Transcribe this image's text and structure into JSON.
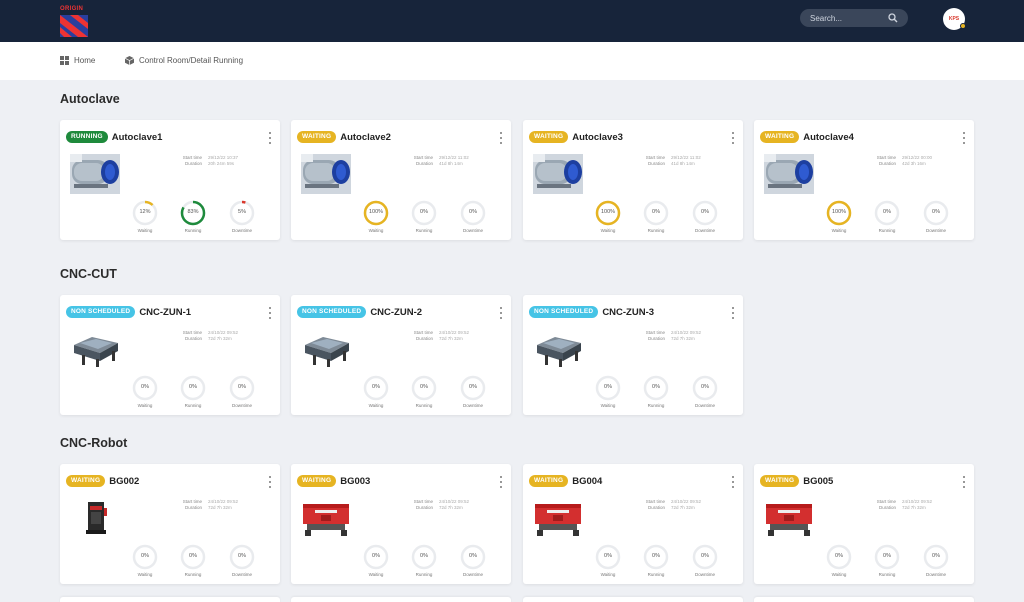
{
  "header": {
    "logo_text": "ORIGIN",
    "search_placeholder": "Search...",
    "avatar_initials": "KPS",
    "colors": {
      "bar": "#17243a",
      "accent": "#d9372b"
    }
  },
  "breadcrumb": {
    "home": "Home",
    "current": "Control Room/Detail Running"
  },
  "status_colors": {
    "RUNNING": "#1e8a3c",
    "WAITING": "#e6b422",
    "NON SCHEDULED": "#46c4e6"
  },
  "info_labels": {
    "start": "Start time",
    "duration": "Duration"
  },
  "sections": [
    {
      "title": "Autoclave",
      "machine_type": "autoclave",
      "cards": [
        {
          "status": "RUNNING",
          "name": "Autoclave1",
          "start": "29/12/22 10:37",
          "duration": "20h 24m 59s",
          "gauges": [
            {
              "label": "Waiting",
              "value": "12%",
              "pct": 12,
              "color": "#e6b422"
            },
            {
              "label": "Running",
              "value": "83%",
              "pct": 83,
              "color": "#1e8a3c"
            },
            {
              "label": "Downtime",
              "value": "5%",
              "pct": 5,
              "color": "#d9372b"
            }
          ]
        },
        {
          "status": "WAITING",
          "name": "Autoclave2",
          "start": "29/12/22 11:02",
          "duration": "41d 8h 14m",
          "gauges": [
            {
              "label": "Waiting",
              "value": "100%",
              "pct": 100,
              "color": "#e6b422"
            },
            {
              "label": "Running",
              "value": "0%",
              "pct": 0,
              "color": "#1e8a3c"
            },
            {
              "label": "Downtime",
              "value": "0%",
              "pct": 0,
              "color": "#d9372b"
            }
          ]
        },
        {
          "status": "WAITING",
          "name": "Autoclave3",
          "start": "29/12/22 11:02",
          "duration": "41d 8h 14m",
          "gauges": [
            {
              "label": "Waiting",
              "value": "100%",
              "pct": 100,
              "color": "#e6b422"
            },
            {
              "label": "Running",
              "value": "0%",
              "pct": 0,
              "color": "#1e8a3c"
            },
            {
              "label": "Downtime",
              "value": "0%",
              "pct": 0,
              "color": "#d9372b"
            }
          ]
        },
        {
          "status": "WAITING",
          "name": "Autoclave4",
          "start": "29/12/22 00:00",
          "duration": "42d 3h 16m",
          "gauges": [
            {
              "label": "Waiting",
              "value": "100%",
              "pct": 100,
              "color": "#e6b422"
            },
            {
              "label": "Running",
              "value": "0%",
              "pct": 0,
              "color": "#1e8a3c"
            },
            {
              "label": "Downtime",
              "value": "0%",
              "pct": 0,
              "color": "#d9372b"
            }
          ]
        }
      ]
    },
    {
      "title": "CNC-CUT",
      "machine_type": "cnc",
      "cards": [
        {
          "status": "NON SCHEDULED",
          "name": "CNC-ZUN-1",
          "start": "24/10/22 09:52",
          "duration": "72d 7h 32m",
          "gauges": [
            {
              "label": "Waiting",
              "value": "0%",
              "pct": 0,
              "color": "#e6b422"
            },
            {
              "label": "Running",
              "value": "0%",
              "pct": 0,
              "color": "#1e8a3c"
            },
            {
              "label": "Downtime",
              "value": "0%",
              "pct": 0,
              "color": "#d9372b"
            }
          ]
        },
        {
          "status": "NON SCHEDULED",
          "name": "CNC-ZUN-2",
          "start": "24/10/22 09:52",
          "duration": "72d 7h 32m",
          "gauges": [
            {
              "label": "Waiting",
              "value": "0%",
              "pct": 0,
              "color": "#e6b422"
            },
            {
              "label": "Running",
              "value": "0%",
              "pct": 0,
              "color": "#1e8a3c"
            },
            {
              "label": "Downtime",
              "value": "0%",
              "pct": 0,
              "color": "#d9372b"
            }
          ]
        },
        {
          "status": "NON SCHEDULED",
          "name": "CNC-ZUN-3",
          "start": "24/10/22 09:52",
          "duration": "72d 7h 32m",
          "gauges": [
            {
              "label": "Waiting",
              "value": "0%",
              "pct": 0,
              "color": "#e6b422"
            },
            {
              "label": "Running",
              "value": "0%",
              "pct": 0,
              "color": "#1e8a3c"
            },
            {
              "label": "Downtime",
              "value": "0%",
              "pct": 0,
              "color": "#d9372b"
            }
          ]
        }
      ]
    },
    {
      "title": "CNC-Robot",
      "machine_type": "press",
      "cards": [
        {
          "status": "WAITING",
          "name": "BG002",
          "start": "24/10/22 09:52",
          "duration": "72d 7h 32m",
          "image": "press-small",
          "gauges": [
            {
              "label": "Waiting",
              "value": "0%",
              "pct": 0,
              "color": "#e6b422"
            },
            {
              "label": "Running",
              "value": "0%",
              "pct": 0,
              "color": "#1e8a3c"
            },
            {
              "label": "Downtime",
              "value": "0%",
              "pct": 0,
              "color": "#d9372b"
            }
          ]
        },
        {
          "status": "WAITING",
          "name": "BG003",
          "start": "24/10/22 09:52",
          "duration": "72d 7h 32m",
          "gauges": [
            {
              "label": "Waiting",
              "value": "0%",
              "pct": 0,
              "color": "#e6b422"
            },
            {
              "label": "Running",
              "value": "0%",
              "pct": 0,
              "color": "#1e8a3c"
            },
            {
              "label": "Downtime",
              "value": "0%",
              "pct": 0,
              "color": "#d9372b"
            }
          ]
        },
        {
          "status": "WAITING",
          "name": "BG004",
          "start": "24/10/22 09:52",
          "duration": "72d 7h 32m",
          "gauges": [
            {
              "label": "Waiting",
              "value": "0%",
              "pct": 0,
              "color": "#e6b422"
            },
            {
              "label": "Running",
              "value": "0%",
              "pct": 0,
              "color": "#1e8a3c"
            },
            {
              "label": "Downtime",
              "value": "0%",
              "pct": 0,
              "color": "#d9372b"
            }
          ]
        },
        {
          "status": "WAITING",
          "name": "BG005",
          "start": "24/10/22 09:52",
          "duration": "72d 7h 32m",
          "gauges": [
            {
              "label": "Waiting",
              "value": "0%",
              "pct": 0,
              "color": "#e6b422"
            },
            {
              "label": "Running",
              "value": "0%",
              "pct": 0,
              "color": "#1e8a3c"
            },
            {
              "label": "Downtime",
              "value": "0%",
              "pct": 0,
              "color": "#d9372b"
            }
          ]
        }
      ]
    }
  ]
}
